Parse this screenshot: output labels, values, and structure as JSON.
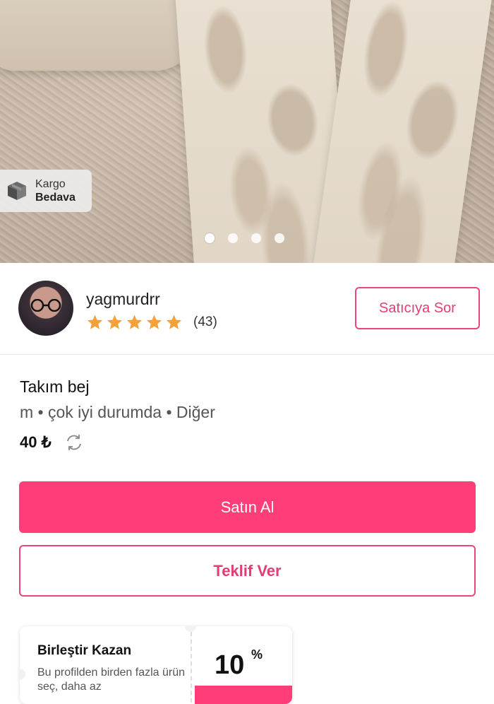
{
  "hero": {
    "cargo_badge": {
      "line1": "Kargo",
      "line2": "Bedava",
      "icon": "box-icon"
    },
    "carousel": {
      "total": 4,
      "active": 0
    }
  },
  "seller": {
    "username": "yagmurdrr",
    "rating": 5,
    "review_count": "(43)",
    "ask_label": "Satıcıya Sor"
  },
  "product": {
    "title": "Takım bej",
    "meta": "m • çok iyi durumda • Diğer",
    "price": "40 ₺",
    "swap_icon": "swap-icon"
  },
  "actions": {
    "buy_label": "Satın Al",
    "offer_label": "Teklif Ver"
  },
  "bundle": {
    "title": "Birleştir Kazan",
    "description": "Bu profilden birden fazla ürün seç, daha az",
    "percent": "10",
    "percent_sign": "%"
  },
  "colors": {
    "accent": "#ff3d79",
    "accent_text": "#e23d74",
    "star": "#f5a13a"
  }
}
